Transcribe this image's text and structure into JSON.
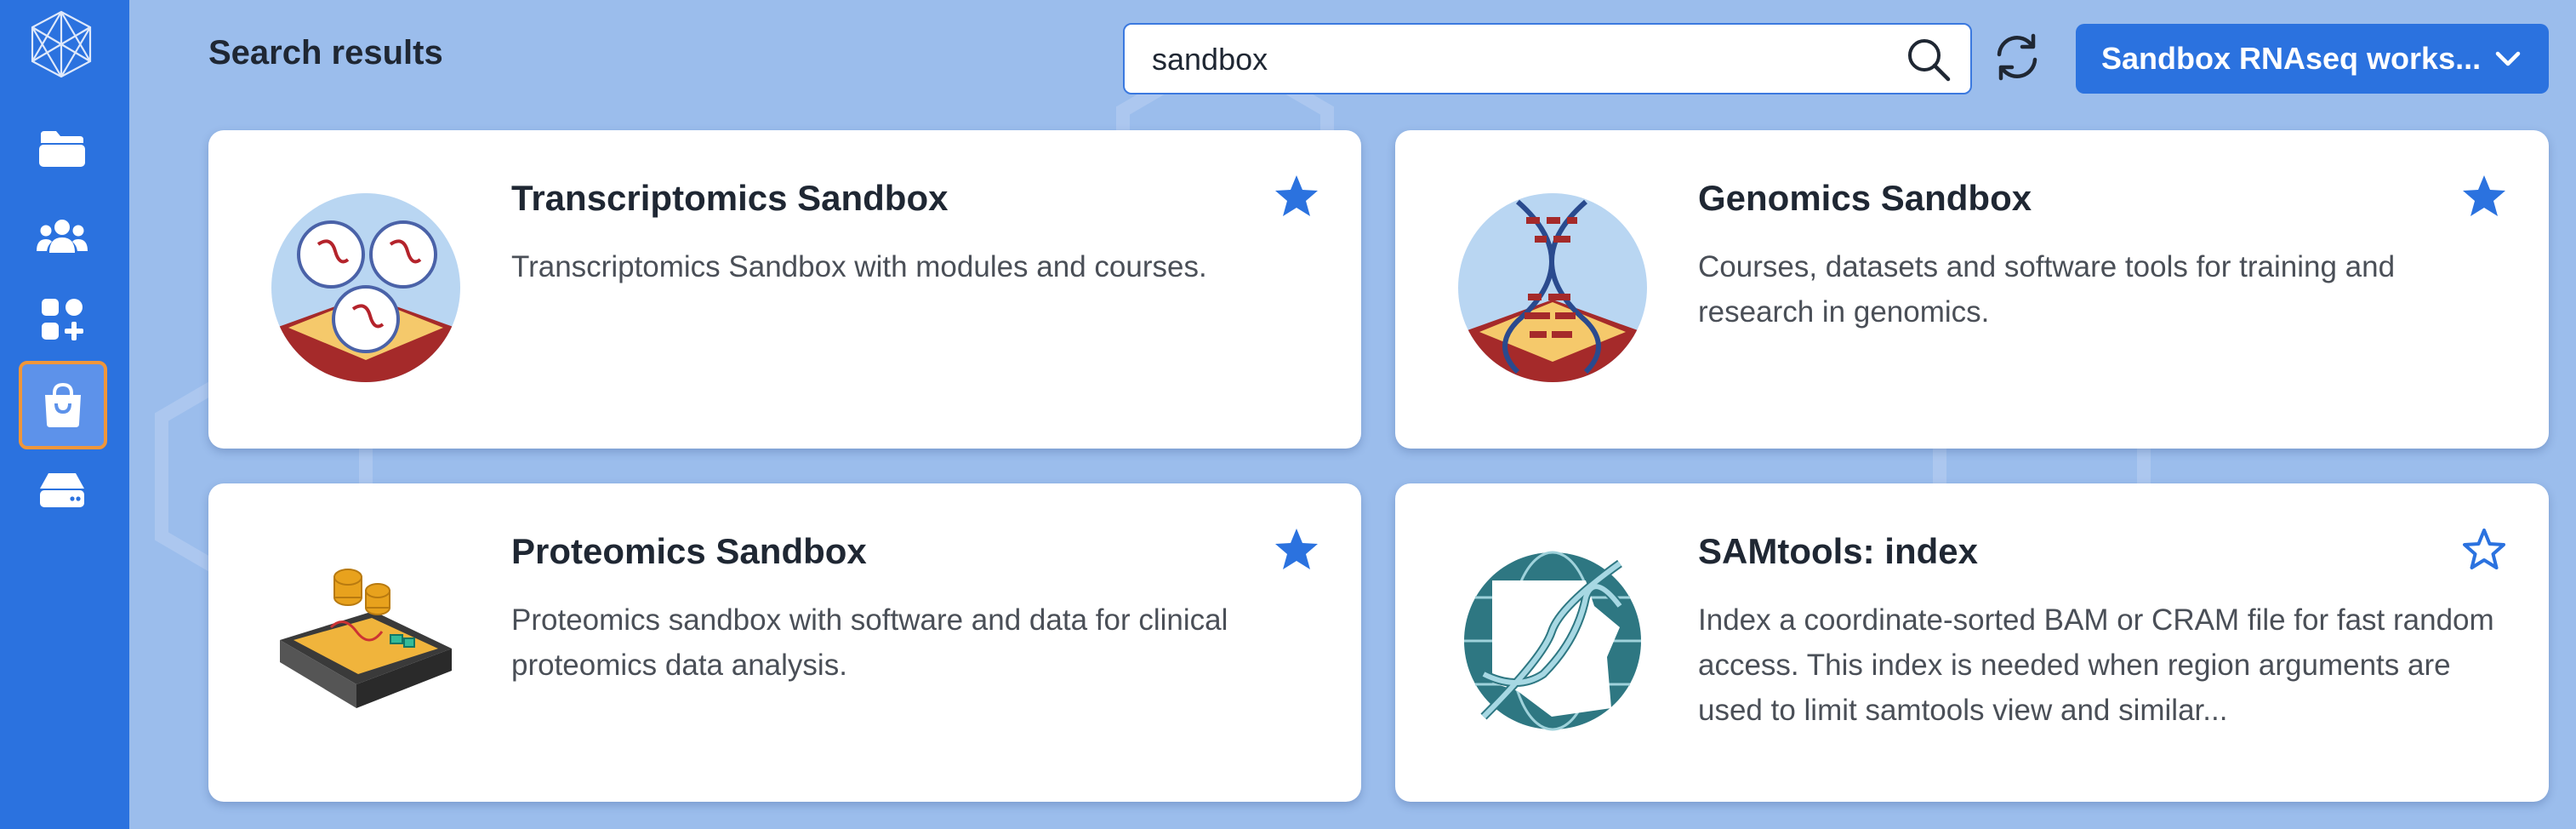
{
  "page": {
    "title": "Search results"
  },
  "search": {
    "value": "sandbox",
    "placeholder": "Search"
  },
  "workspace": {
    "label": "Sandbox RNAseq works..."
  },
  "sidebar": {
    "items": [
      {
        "name": "files",
        "icon": "folder-icon"
      },
      {
        "name": "users",
        "icon": "users-icon"
      },
      {
        "name": "apps",
        "icon": "apps-add-icon"
      },
      {
        "name": "store",
        "icon": "shopping-bag-icon",
        "active": true
      },
      {
        "name": "storage",
        "icon": "drive-icon"
      }
    ]
  },
  "cards": [
    {
      "title": "Transcriptomics Sandbox",
      "description": "Transcriptomics Sandbox with modules and courses.",
      "starred": true,
      "image": "transcriptomics-logo"
    },
    {
      "title": "Genomics Sandbox",
      "description": "Courses, datasets and software tools for training and research in genomics.",
      "starred": true,
      "image": "genomics-logo"
    },
    {
      "title": "Proteomics Sandbox",
      "description": "Proteomics sandbox with software and data for clinical proteomics data analysis.",
      "starred": true,
      "image": "proteomics-logo"
    },
    {
      "title": "SAMtools: index",
      "description": "Index a coordinate-sorted BAM or CRAM file for fast random access. This index is needed when region arguments are used to limit samtools view and similar...",
      "starred": false,
      "image": "samtools-logo"
    }
  ],
  "colors": {
    "accent": "#2b72df",
    "background": "#9bbdec",
    "star": "#2b72df",
    "active_outline": "#f0963a"
  }
}
